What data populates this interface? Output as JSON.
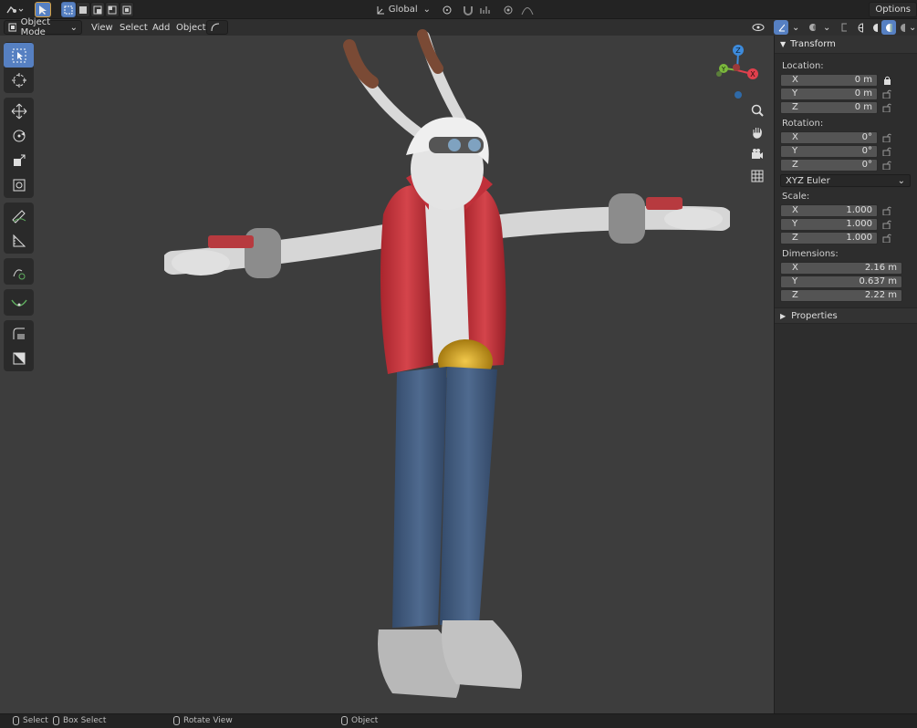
{
  "topbar": {
    "transform_orientation": "Global",
    "options_label": "Options"
  },
  "viewport_header": {
    "mode": "Object Mode",
    "menu": [
      "View",
      "Select",
      "Add",
      "Object"
    ]
  },
  "npanel": {
    "title": "Transform",
    "location_label": "Location:",
    "location": [
      {
        "axis": "X",
        "value": "0 m"
      },
      {
        "axis": "Y",
        "value": "0 m"
      },
      {
        "axis": "Z",
        "value": "0 m"
      }
    ],
    "rotation_label": "Rotation:",
    "rotation": [
      {
        "axis": "X",
        "value": "0°"
      },
      {
        "axis": "Y",
        "value": "0°"
      },
      {
        "axis": "Z",
        "value": "0°"
      }
    ],
    "rotation_mode": "XYZ Euler",
    "scale_label": "Scale:",
    "scale": [
      {
        "axis": "X",
        "value": "1.000"
      },
      {
        "axis": "Y",
        "value": "1.000"
      },
      {
        "axis": "Z",
        "value": "1.000"
      }
    ],
    "dimensions_label": "Dimensions:",
    "dimensions": [
      {
        "axis": "X",
        "value": "2.16 m"
      },
      {
        "axis": "Y",
        "value": "0.637 m"
      },
      {
        "axis": "Z",
        "value": "2.22 m"
      }
    ],
    "properties_label": "Properties"
  },
  "gizmo": {
    "x": "X",
    "y": "Y",
    "z": "Z"
  },
  "statusbar": {
    "select": "Select",
    "box_select": "Box Select",
    "rotate_view": "Rotate View",
    "object": "Object"
  },
  "colors": {
    "accent": "#5680c2",
    "x_axis": "#e0404d",
    "y_axis": "#7bb83c",
    "z_axis": "#3d8bdc"
  }
}
